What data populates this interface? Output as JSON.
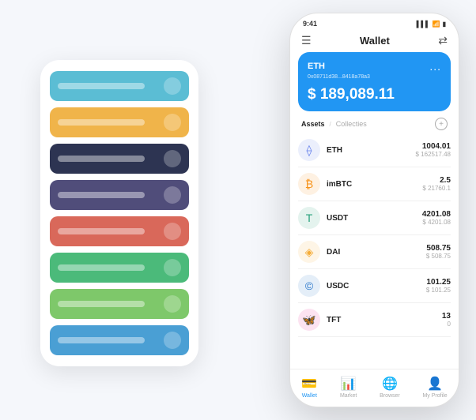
{
  "statusBar": {
    "time": "9:41",
    "signal": "▌▌▌",
    "wifi": "WiFi",
    "battery": "🔋"
  },
  "header": {
    "title": "Wallet",
    "menuIcon": "☰",
    "expandIcon": "⇄"
  },
  "ethCard": {
    "label": "ETH",
    "address": "0x08711d38...8418a78a3",
    "balance": "$ 189,089.11",
    "dotsMenu": "..."
  },
  "assetsTabs": {
    "active": "Assets",
    "divider": "/",
    "inactive": "Collecties"
  },
  "tokens": [
    {
      "name": "ETH",
      "amount": "1004.01",
      "usd": "$ 162517.48",
      "icon": "⟠",
      "color": "#627EEA"
    },
    {
      "name": "imBTC",
      "amount": "2.5",
      "usd": "$ 21760.1",
      "icon": "₿",
      "color": "#F7931A"
    },
    {
      "name": "USDT",
      "amount": "4201.08",
      "usd": "$ 4201.08",
      "icon": "T",
      "color": "#26A17B"
    },
    {
      "name": "DAI",
      "amount": "508.75",
      "usd": "$ 508.75",
      "icon": "◈",
      "color": "#F5AC37"
    },
    {
      "name": "USDC",
      "amount": "101.25",
      "usd": "$ 101.25",
      "icon": "©",
      "color": "#2775CA"
    },
    {
      "name": "TFT",
      "amount": "13",
      "usd": "0",
      "icon": "🦋",
      "color": "#E91E8C"
    }
  ],
  "bottomNav": [
    {
      "label": "Wallet",
      "icon": "💳",
      "active": true
    },
    {
      "label": "Market",
      "icon": "📊",
      "active": false
    },
    {
      "label": "Browser",
      "icon": "🌐",
      "active": false
    },
    {
      "label": "My Profile",
      "icon": "👤",
      "active": false
    }
  ],
  "cardStack": [
    {
      "colorClass": "c1"
    },
    {
      "colorClass": "c2"
    },
    {
      "colorClass": "c3"
    },
    {
      "colorClass": "c4"
    },
    {
      "colorClass": "c5"
    },
    {
      "colorClass": "c6"
    },
    {
      "colorClass": "c7"
    },
    {
      "colorClass": "c8"
    }
  ]
}
